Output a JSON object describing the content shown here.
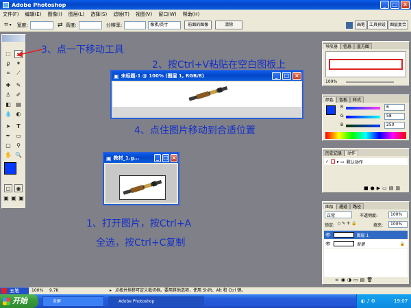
{
  "app": {
    "title": "Adobe Photoshop"
  },
  "menu": [
    "文件(F)",
    "编辑(E)",
    "图像(I)",
    "图层(L)",
    "选择(S)",
    "滤镜(T)",
    "视图(V)",
    "窗口(W)",
    "帮助(H)"
  ],
  "options": {
    "width_label": "宽度:",
    "height_label": "高度:",
    "resolution_label": "分辨率:",
    "resolution_unit": "像素/英寸",
    "front_image_btn": "前面的图像",
    "clear_btn": "清除"
  },
  "palette_well": {
    "tab1": "画笔",
    "tab2": "工具预设",
    "tab3": "图层复合"
  },
  "doc1": {
    "title": "未标题-1 @ 100% (图层 1, RGB/8)"
  },
  "doc2": {
    "title": "教材_1.g..."
  },
  "notes": {
    "n1": "3、点一下移动工具",
    "n2": "2、按Ctrl+V粘贴在空白图板上",
    "n3": "4、点住图片移动到合适位置",
    "n4": "1、打开图片，按Ctrl+A",
    "n5": "全选，按Ctrl+C复制"
  },
  "navigator": {
    "tab1": "导航器",
    "tab2": "信息",
    "tab3": "直方图",
    "zoom": "100%"
  },
  "color_panel": {
    "tab1": "颜色",
    "tab2": "色板",
    "tab3": "样式",
    "r_label": "R",
    "r": "6",
    "g_label": "G",
    "g": "58",
    "b_label": "B",
    "b": "250",
    "fg_color": "#063afa"
  },
  "history_panel": {
    "tab1": "历史记录",
    "tab2": "动作",
    "item": "默认动作"
  },
  "layers_panel": {
    "tab1": "图层",
    "tab2": "通道",
    "tab3": "路径",
    "mode": "正常",
    "opacity_label": "不透明度:",
    "opacity": "100%",
    "lock_label": "锁定:",
    "fill_label": "填充:",
    "fill": "100%",
    "layer1": "图层 1",
    "layer2": "背景"
  },
  "status": {
    "zoom": "100%",
    "size": "9.7K",
    "hint": "点按并拖移可定义裁切框。要用其他选项，使用 Shift、Alt 和 Ctrl 键。",
    "ime": "五笔"
  },
  "taskbar": {
    "start": "开始",
    "btn1": "全屏",
    "btn2": "Adobe Photoshop",
    "clock": "19:07"
  }
}
